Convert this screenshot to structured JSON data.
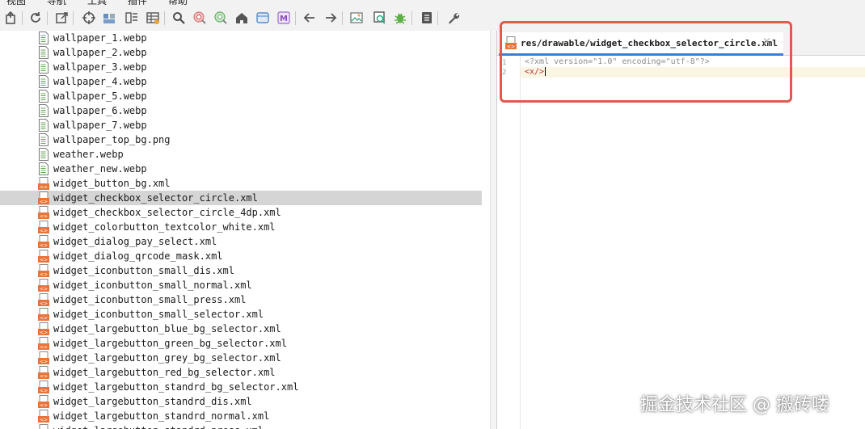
{
  "menu": [
    "视图",
    "导航",
    "工具",
    "插件",
    "帮助"
  ],
  "toolbar": {
    "buttons": [
      {
        "name": "open-file-icon",
        "icon": "open-file"
      },
      {
        "name": "refresh-icon",
        "icon": "refresh"
      },
      {
        "name": "export-icon",
        "icon": "export"
      },
      {
        "name": "target-icon",
        "icon": "target"
      },
      {
        "name": "package-icon",
        "icon": "package"
      },
      {
        "name": "list-view-icon",
        "icon": "list-view"
      },
      {
        "name": "table-grid-icon",
        "icon": "table-grid"
      },
      {
        "name": "search-icon",
        "icon": "search"
      },
      {
        "name": "search-class-icon",
        "icon": "search-class"
      },
      {
        "name": "search-usage-icon",
        "icon": "search-usage"
      },
      {
        "name": "home-icon",
        "icon": "home"
      },
      {
        "name": "window-icon",
        "icon": "window"
      },
      {
        "name": "manifest-icon",
        "icon": "manifest",
        "letter": "M"
      },
      {
        "name": "back-arrow-icon",
        "icon": "arrow-left"
      },
      {
        "name": "forward-arrow-icon",
        "icon": "arrow-right"
      },
      {
        "name": "image-view-icon",
        "icon": "image-view"
      },
      {
        "name": "deobfuscate-icon",
        "icon": "deobfuscate"
      },
      {
        "name": "debug-bug-icon",
        "icon": "bug"
      },
      {
        "name": "log-icon",
        "icon": "log"
      },
      {
        "name": "settings-wrench-icon",
        "icon": "wrench"
      }
    ]
  },
  "tree": {
    "selected": "widget_checkbox_selector_circle.xml",
    "items": [
      {
        "name": "wallpaper_1.webp",
        "type": "image"
      },
      {
        "name": "wallpaper_2.webp",
        "type": "image"
      },
      {
        "name": "wallpaper_3.webp",
        "type": "image"
      },
      {
        "name": "wallpaper_4.webp",
        "type": "image"
      },
      {
        "name": "wallpaper_5.webp",
        "type": "image"
      },
      {
        "name": "wallpaper_6.webp",
        "type": "image"
      },
      {
        "name": "wallpaper_7.webp",
        "type": "image"
      },
      {
        "name": "wallpaper_top_bg.png",
        "type": "image"
      },
      {
        "name": "weather.webp",
        "type": "image"
      },
      {
        "name": "weather_new.webp",
        "type": "image"
      },
      {
        "name": "widget_button_bg.xml",
        "type": "xml"
      },
      {
        "name": "widget_checkbox_selector_circle.xml",
        "type": "xml"
      },
      {
        "name": "widget_checkbox_selector_circle_4dp.xml",
        "type": "xml"
      },
      {
        "name": "widget_colorbutton_textcolor_white.xml",
        "type": "xml"
      },
      {
        "name": "widget_dialog_pay_select.xml",
        "type": "xml"
      },
      {
        "name": "widget_dialog_qrcode_mask.xml",
        "type": "xml"
      },
      {
        "name": "widget_iconbutton_small_dis.xml",
        "type": "xml"
      },
      {
        "name": "widget_iconbutton_small_normal.xml",
        "type": "xml"
      },
      {
        "name": "widget_iconbutton_small_press.xml",
        "type": "xml"
      },
      {
        "name": "widget_iconbutton_small_selector.xml",
        "type": "xml"
      },
      {
        "name": "widget_largebutton_blue_bg_selector.xml",
        "type": "xml"
      },
      {
        "name": "widget_largebutton_green_bg_selector.xml",
        "type": "xml"
      },
      {
        "name": "widget_largebutton_grey_bg_selector.xml",
        "type": "xml"
      },
      {
        "name": "widget_largebutton_red_bg_selector.xml",
        "type": "xml"
      },
      {
        "name": "widget_largebutton_standrd_bg_selector.xml",
        "type": "xml"
      },
      {
        "name": "widget_largebutton_standrd_dis.xml",
        "type": "xml"
      },
      {
        "name": "widget_largebutton_standrd_normal.xml",
        "type": "xml"
      },
      {
        "name": "widget_largebutton_standrd_press.xml",
        "type": "xml"
      }
    ]
  },
  "editor": {
    "tab": {
      "title": "res/drawable/widget_checkbox_selector_circle.xml",
      "close": "×"
    },
    "lines": [
      {
        "number": "1",
        "text": "<?xml version=\"1.0\" encoding=\"utf-8\"?>",
        "style": "decl"
      },
      {
        "number": "2",
        "text": "<x/>",
        "style": "tag"
      }
    ]
  },
  "colors": {
    "highlight_border": "#e05a50",
    "tab_underline": "#3b7fd4",
    "xml_icon": "#e8743b",
    "selection": "#d5d5d5"
  },
  "watermark": "掘金技术社区 @ 搬砖喽"
}
